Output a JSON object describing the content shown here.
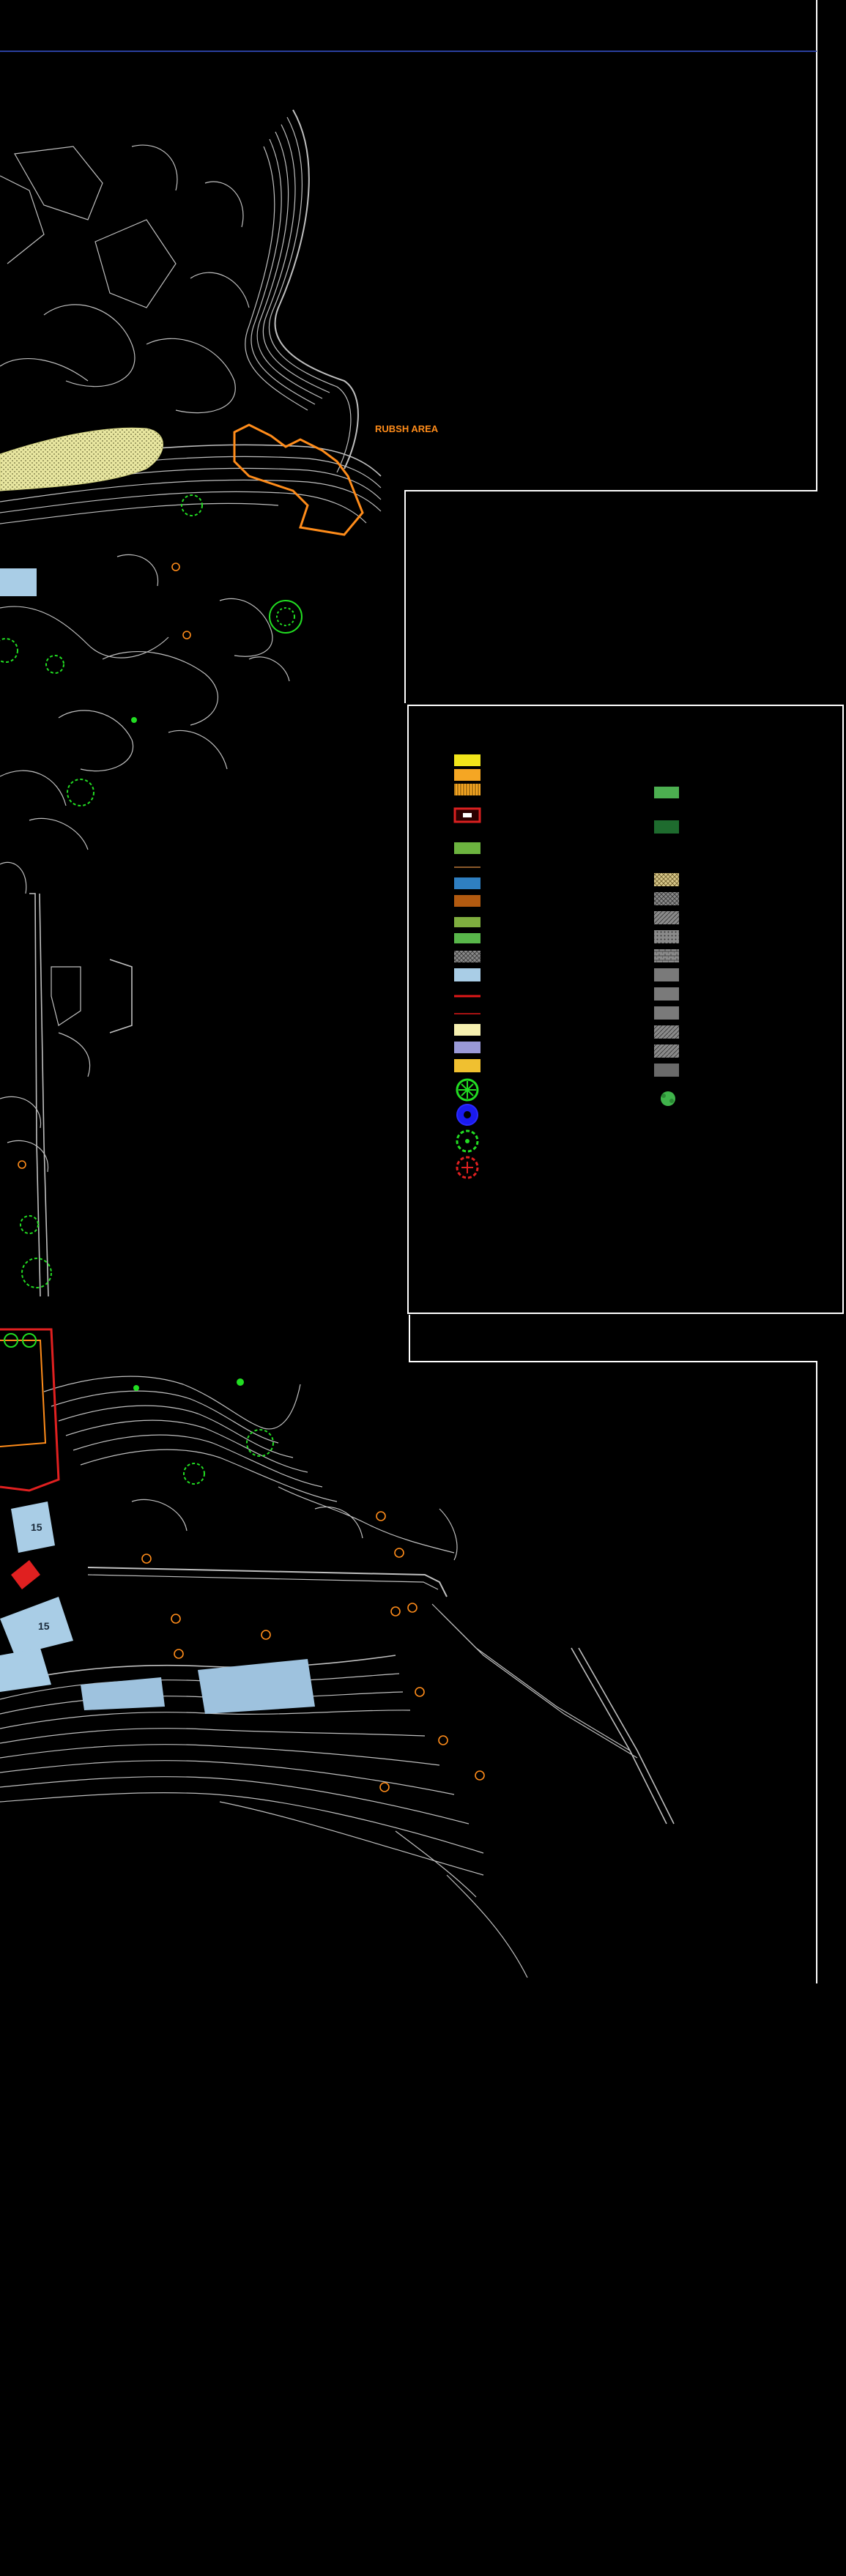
{
  "title_label": "RUBSH AREA",
  "building_labels": [
    "15",
    "15"
  ],
  "colors": {
    "background": "#000000",
    "contour": "#bfbfbf",
    "frame": "#ffffff",
    "blue_rule": "#2a3f9e",
    "orange": "#ff8c1a",
    "green": "#22dd22",
    "red": "#e02020",
    "building": "#a9cde6",
    "yellow_hatch": "#e8e6a0"
  },
  "legend_left": [
    {
      "icon": "yellow-fill",
      "color": "#f2e51a"
    },
    {
      "icon": "orange-fill",
      "color": "#f5a623"
    },
    {
      "icon": "orange-hatched",
      "color": "#f5a623"
    },
    {
      "icon": "red-outlined-swatch",
      "color": "#d92020"
    },
    {
      "icon": "green-fill",
      "color": "#6cb33f"
    },
    {
      "icon": "brown-line",
      "color": "#8b5a2b"
    },
    {
      "icon": "blue-fill",
      "color": "#2f7fc1"
    },
    {
      "icon": "brown-fill",
      "color": "#b25a10"
    },
    {
      "icon": "olive-fill",
      "color": "#7fae3f"
    },
    {
      "icon": "green-fill",
      "color": "#58b64a"
    },
    {
      "icon": "grey-hatched",
      "color": "#9a9a9a"
    },
    {
      "icon": "light-blue-fill",
      "color": "#a9cde6"
    },
    {
      "icon": "red-line",
      "color": "#e01818"
    },
    {
      "icon": "red-line-thin",
      "color": "#e01818"
    },
    {
      "icon": "cream-fill",
      "color": "#f6f0b0"
    },
    {
      "icon": "lavender-fill",
      "color": "#9a9ad8"
    },
    {
      "icon": "gold-fill",
      "color": "#f0c030"
    },
    {
      "icon": "green-tree-symbol",
      "color": "#22dd22"
    },
    {
      "icon": "blue-tree-symbol",
      "color": "#1a1aee"
    },
    {
      "icon": "green-dashed-tree-symbol",
      "color": "#22dd22"
    },
    {
      "icon": "red-dashed-tree-symbol",
      "color": "#e02020"
    }
  ],
  "legend_right": [
    {
      "icon": "green-fill",
      "color": "#4caf50"
    },
    {
      "icon": "dark-green-fill",
      "color": "#1e6b2e"
    },
    {
      "icon": "tan-crosshatch",
      "color": "#d8c88a"
    },
    {
      "icon": "grey-crosshatch",
      "color": "#9a9a9a"
    },
    {
      "icon": "grey-hatch",
      "color": "#8a8a8a"
    },
    {
      "icon": "grey-dots",
      "color": "#8a8a8a"
    },
    {
      "icon": "grey-brick",
      "color": "#8a8a8a"
    },
    {
      "icon": "grey-fill",
      "color": "#7a7a7a"
    },
    {
      "icon": "grey-fill-2",
      "color": "#7a7a7a"
    },
    {
      "icon": "grey-fill-3",
      "color": "#7a7a7a"
    },
    {
      "icon": "grey-diagonal",
      "color": "#8a8a8a"
    },
    {
      "icon": "grey-diagonal-2",
      "color": "#8a8a8a"
    },
    {
      "icon": "grey-fill-4",
      "color": "#6a6a6a"
    },
    {
      "icon": "green-shrub-symbol",
      "color": "#3fb34a"
    }
  ]
}
